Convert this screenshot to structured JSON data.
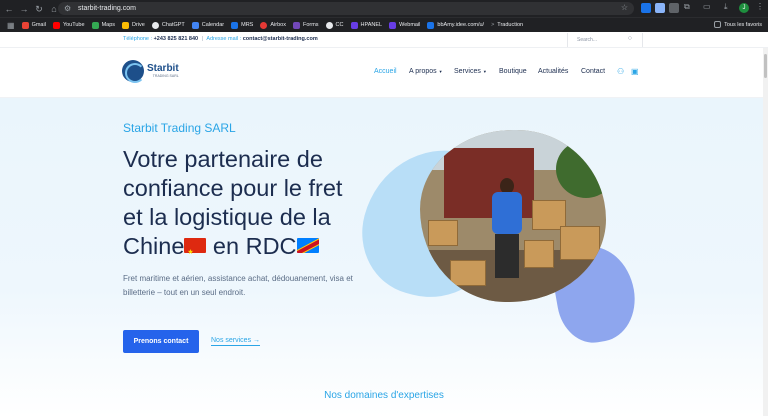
{
  "browser": {
    "url": "starbit-trading.com",
    "bookmarks": [
      "Gmail",
      "YouTube",
      "Maps",
      "Drive",
      "ChatGPT",
      "Calendar",
      "MRS",
      "Airbox",
      "Forms",
      "CC",
      "HPANEL",
      "Webmail",
      "bbAmy.idee.com/u/",
      "Traduction"
    ],
    "all_bookmarks": "Tous les favoris",
    "profile_initial": "J"
  },
  "topbar": {
    "phone_label": "Téléphone :",
    "phone_value": "+243 825 821 840",
    "email_label": "Adresse mail :",
    "email_value": "contact@starbit-trading.com",
    "search_placeholder": "Search..."
  },
  "brand": {
    "name": "Starbit",
    "tagline": "TRADING SARL"
  },
  "nav": {
    "items": [
      "Accueil",
      "A propos",
      "Services",
      "Boutique",
      "Actualités",
      "Contact"
    ],
    "active": "Accueil"
  },
  "hero": {
    "eyebrow": "Starbit Trading SARL",
    "headline_1": "Votre partenaire de",
    "headline_2": "confiance pour le fret",
    "headline_3": "et la logistique de la",
    "headline_4a": "Chine",
    "headline_4b": " en RDC",
    "description": "Fret maritime et aérien, assistance achat, dédouanement, visa et billetterie – tout en un seul endroit.",
    "cta_primary": "Prenons contact",
    "cta_secondary": "Nos services →"
  },
  "section": {
    "title": "Nos domaines d'expertises"
  },
  "colors": {
    "accent": "#2aa5e6",
    "primary": "#2563eb",
    "navy": "#1c2d4f"
  }
}
